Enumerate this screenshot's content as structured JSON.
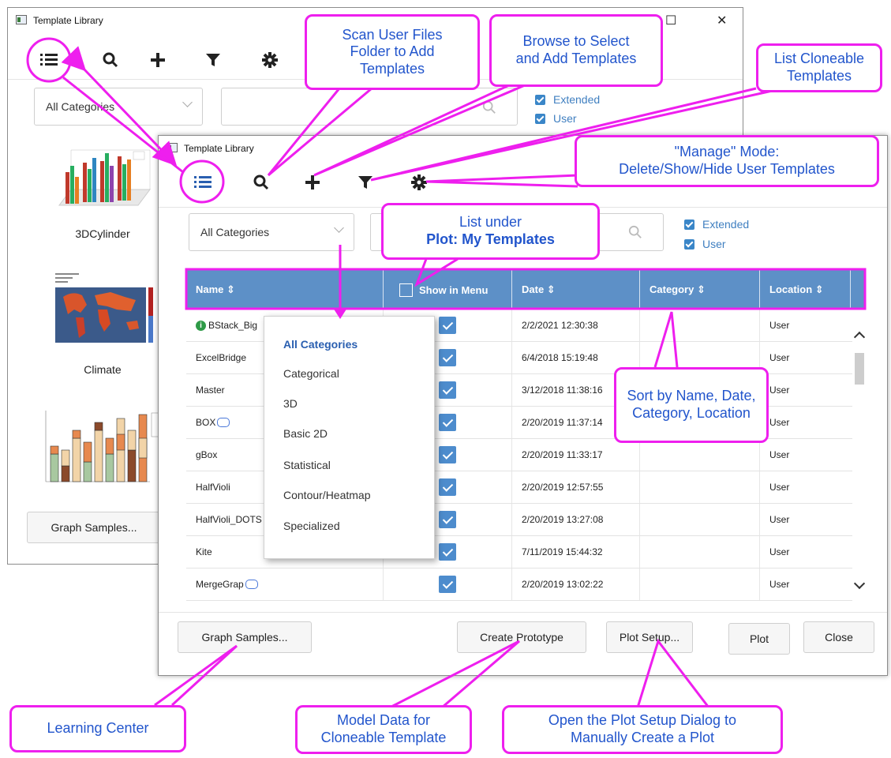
{
  "back_window": {
    "title": "Template Library",
    "category_combo": "All Categories",
    "checkboxes": [
      "Extended",
      "User"
    ],
    "thumbnails": [
      "3DCylinder",
      "Climate"
    ],
    "graph_samples_button": "Graph Samples..."
  },
  "front_window": {
    "title": "Template Library",
    "category_combo": "All Categories",
    "checkboxes": [
      "Extended",
      "User"
    ],
    "columns": {
      "name": "Name ⇕",
      "show_in_menu": "Show in Menu",
      "date": "Date ⇕",
      "category": "Category ⇕",
      "location": "Location ⇕"
    },
    "rows": [
      {
        "name": "BStack_Big",
        "date": "2/2/2021 12:30:38",
        "location": "User"
      },
      {
        "name": "ExcelBridge",
        "date": "6/4/2018 15:19:48",
        "location": "User"
      },
      {
        "name": "Master",
        "date": "3/12/2018 11:38:16",
        "location": "User"
      },
      {
        "name": "BOX",
        "date": "2/20/2019 11:37:14",
        "location": "User"
      },
      {
        "name": "gBox",
        "date": "2/20/2019 11:33:17",
        "location": "User"
      },
      {
        "name": "HalfVioli",
        "date": "2/20/2019 12:57:55",
        "location": "User"
      },
      {
        "name": "HalfVioli_DOTS",
        "date": "2/20/2019 13:27:08",
        "location": "User"
      },
      {
        "name": "Kite",
        "date": "7/11/2019 15:44:32",
        "location": "User"
      },
      {
        "name": "MergeGrap",
        "date": "2/20/2019 13:02:22",
        "location": "User"
      }
    ],
    "dropdown_items": [
      "All Categories",
      "Categorical",
      "3D",
      "Basic 2D",
      "Statistical",
      "Contour/Heatmap",
      "Specialized"
    ],
    "buttons": {
      "graph_samples": "Graph Samples...",
      "create_prototype": "Create Prototype",
      "plot_setup": "Plot Setup...",
      "plot": "Plot",
      "close": "Close"
    }
  },
  "callouts": {
    "scan": "Scan User Files Folder to Add Templates",
    "browse": "Browse to Select and Add Templates",
    "cloneable": "List Cloneable Templates",
    "manage_line1": "\"Manage\" Mode:",
    "manage_line2": "Delete/Show/Hide User Templates",
    "list_under_line1": "List under",
    "list_under_line2": "Plot: My Templates",
    "sort": "Sort by Name, Date, Category, Location",
    "learning": "Learning Center",
    "model": "Model Data for Cloneable Template",
    "plot_setup": "Open the Plot Setup Dialog to Manually Create a Plot"
  },
  "colors": {
    "accent_magenta": "#ee1fee",
    "callout_text": "#2255cc",
    "header_blue": "#5d90c7",
    "checkbox_blue": "#4d8ccd"
  }
}
